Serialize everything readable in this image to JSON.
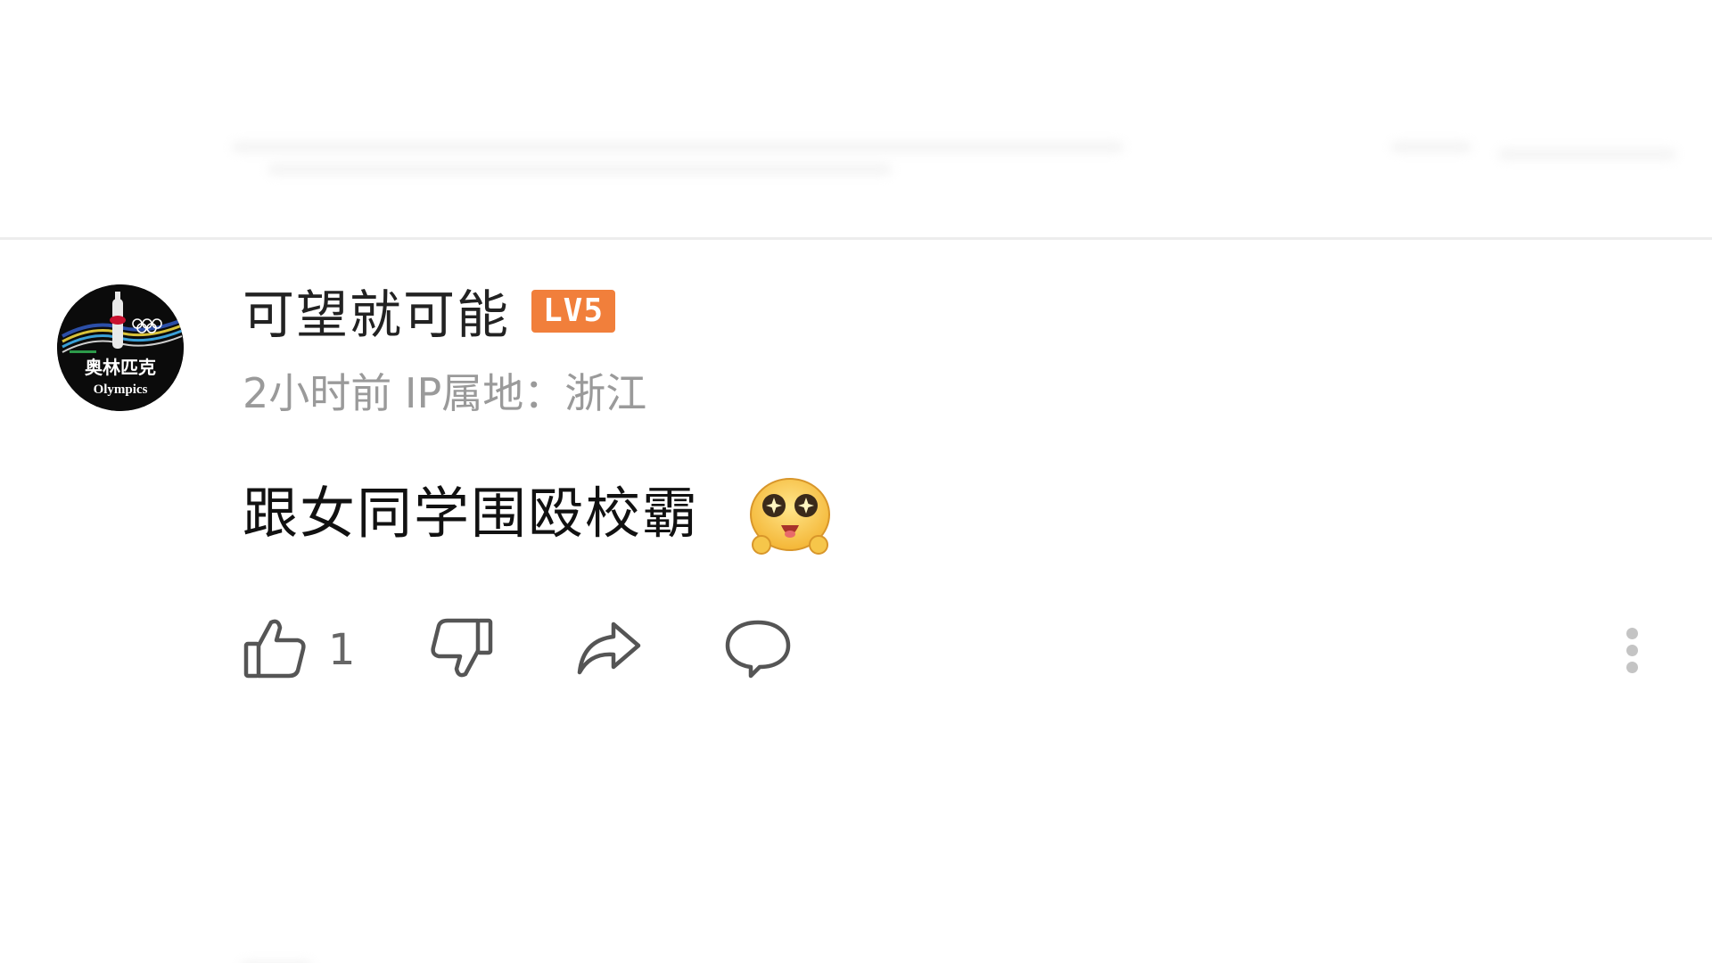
{
  "comment": {
    "username": "可望就可能",
    "level_badge": "LV5",
    "time": "2小时前",
    "ip_location": "IP属地：浙江",
    "text": "跟女同学围殴校霸",
    "emoji": "star-eyes-emoji",
    "avatar": {
      "line1": "奥林匹克",
      "line2": "Olympics"
    },
    "actions": {
      "like_count": "1",
      "like_icon": "thumbs-up-icon",
      "dislike_icon": "thumbs-down-icon",
      "share_icon": "share-arrow-icon",
      "reply_icon": "speech-bubble-icon",
      "more_icon": "vertical-ellipsis-icon"
    }
  },
  "colors": {
    "level_badge": "#f17f3b",
    "username": "#222222",
    "meta": "#9a9a9a",
    "icon": "#555555"
  }
}
